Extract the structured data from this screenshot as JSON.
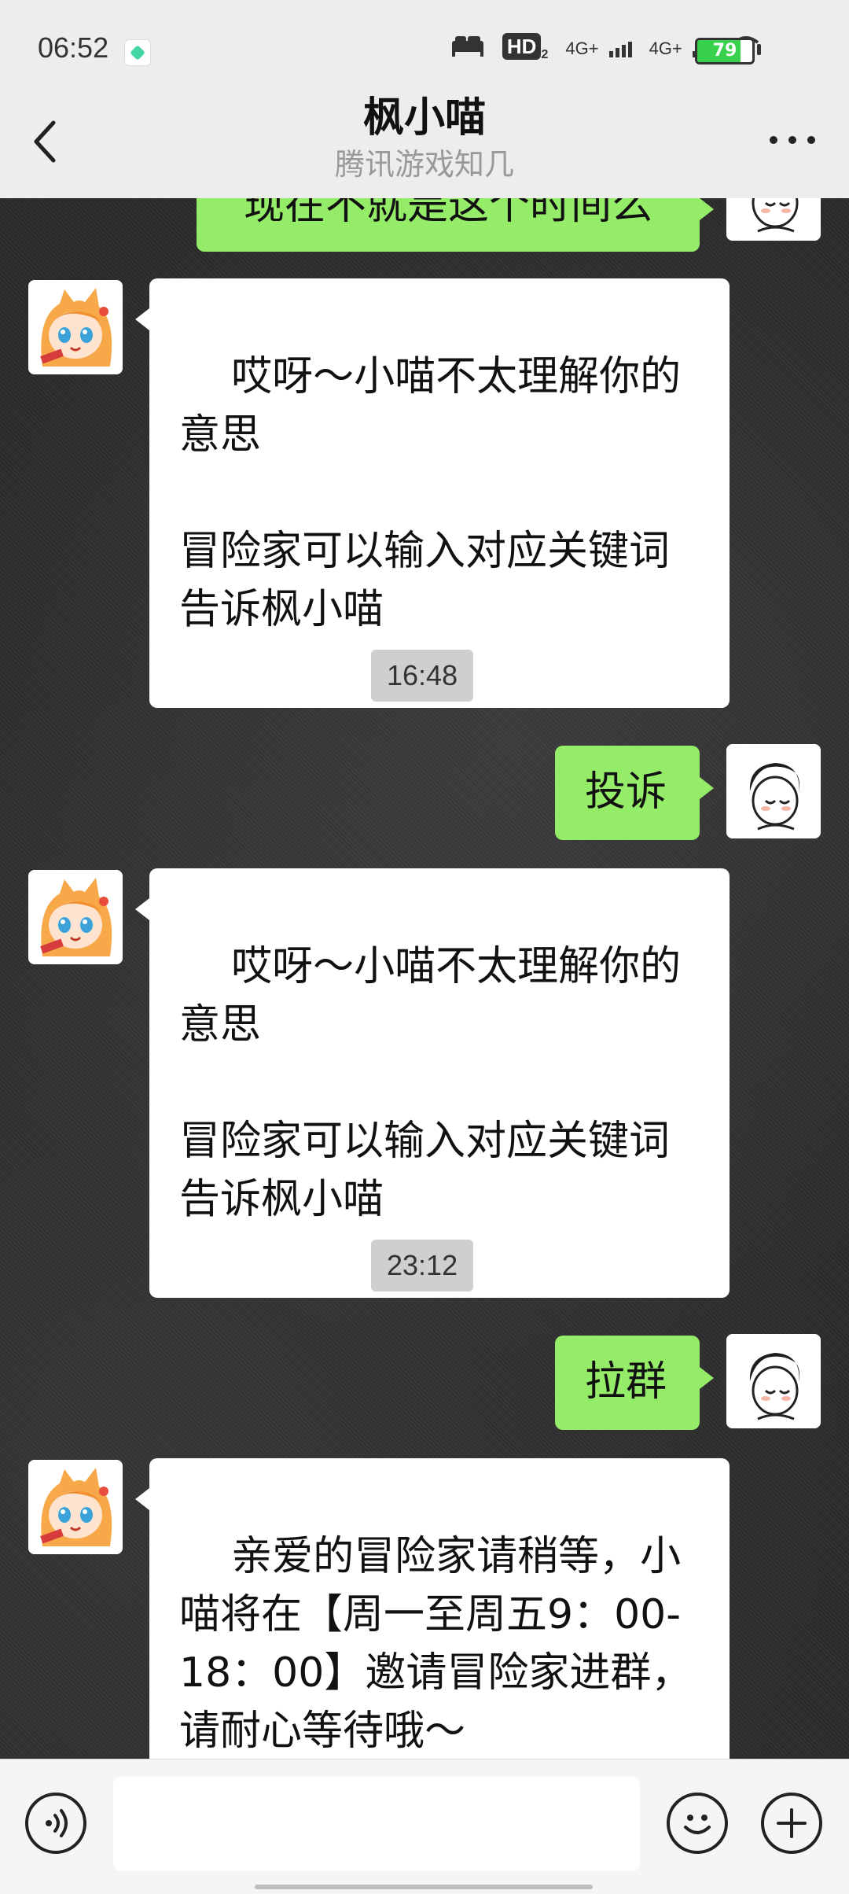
{
  "status_bar": {
    "time": "06:52",
    "hd_label": "HD",
    "hd_sub": "2",
    "network_1": "4G+",
    "network_2": "4G+",
    "battery_level": 79,
    "battery_text": "79"
  },
  "header": {
    "title": "枫小喵",
    "subtitle": "腾讯游戏知几"
  },
  "messages": [
    {
      "from": "me",
      "text": "现在不就是这个时间么"
    },
    {
      "from": "bot",
      "text": "哎呀～小喵不太理解你的意思\n\n冒险家可以输入对应关键词告诉枫小喵"
    },
    {
      "type": "time",
      "text": "16:48"
    },
    {
      "from": "me",
      "text": "投诉"
    },
    {
      "from": "bot",
      "text": "哎呀～小喵不太理解你的意思\n\n冒险家可以输入对应关键词告诉枫小喵"
    },
    {
      "type": "time",
      "text": "23:12"
    },
    {
      "from": "me",
      "text": "拉群"
    },
    {
      "from": "bot",
      "text": "亲爱的冒险家请稍等，小喵将在【周一至周五9：00-18：00】邀请冒险家进群，请耐心等待哦～"
    }
  ],
  "input": {
    "value": ""
  },
  "icons": {
    "back": "back-arrow-icon",
    "more": "more-dots-icon",
    "voice": "voice-icon",
    "emoji": "emoji-icon",
    "plus": "plus-icon"
  },
  "colors": {
    "header_bg": "#ededed",
    "me_bubble": "#95ec69",
    "bot_bubble": "#ffffff",
    "time_pill": "#cfcfcf",
    "battery": "#38d14b"
  }
}
